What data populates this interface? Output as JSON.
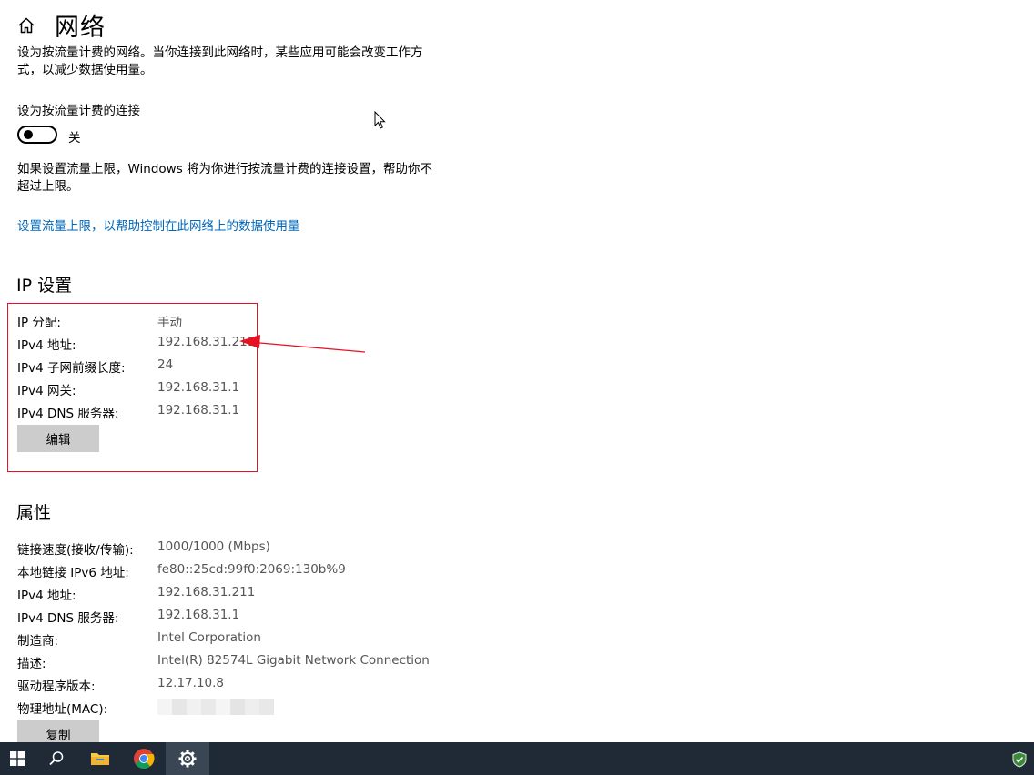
{
  "header": {
    "title": "网络",
    "home_icon": "home-icon"
  },
  "metered": {
    "description": "设为按流量计费的网络。当你连接到此网络时，某些应用可能会改变工作方式，以减少数据使用量。",
    "toggle_label": "设为按流量计费的连接",
    "toggle_state": "关",
    "limit_description": "如果设置流量上限，Windows 将为你进行按流量计费的连接设置，帮助你不超过上限。",
    "limit_link": "设置流量上限，以帮助控制在此网络上的数据使用量"
  },
  "ip_settings": {
    "title": "IP 设置",
    "rows": [
      {
        "key": "IP 分配:",
        "value": "手动"
      },
      {
        "key": "IPv4 地址:",
        "value": "192.168.31.211"
      },
      {
        "key": "IPv4 子网前缀长度:",
        "value": "24"
      },
      {
        "key": "IPv4 网关:",
        "value": "192.168.31.1"
      },
      {
        "key": "IPv4 DNS 服务器:",
        "value": "192.168.31.1"
      }
    ],
    "edit_button": "编辑"
  },
  "properties": {
    "title": "属性",
    "rows": [
      {
        "key": "链接速度(接收/传输):",
        "value": "1000/1000 (Mbps)"
      },
      {
        "key": "本地链接 IPv6 地址:",
        "value": "fe80::25cd:99f0:2069:130b%9"
      },
      {
        "key": "IPv4 地址:",
        "value": "192.168.31.211"
      },
      {
        "key": "IPv4 DNS 服务器:",
        "value": "192.168.31.1"
      },
      {
        "key": "制造商:",
        "value": "Intel Corporation"
      },
      {
        "key": "描述:",
        "value": "Intel(R) 82574L Gigabit Network Connection"
      },
      {
        "key": "驱动程序版本:",
        "value": "12.17.10.8"
      },
      {
        "key": "物理地址(MAC):",
        "value": ""
      }
    ],
    "copy_button": "复制"
  },
  "taskbar": {
    "items": [
      "windows-start-icon",
      "search-icon",
      "file-explorer-icon",
      "chrome-icon",
      "settings-gear-icon"
    ],
    "tray": [
      "defender-shield-icon"
    ]
  },
  "colors": {
    "link": "#0067b8",
    "annotation_red": "#e81123",
    "taskbar": "#1f2a36",
    "button": "#cccccc"
  }
}
